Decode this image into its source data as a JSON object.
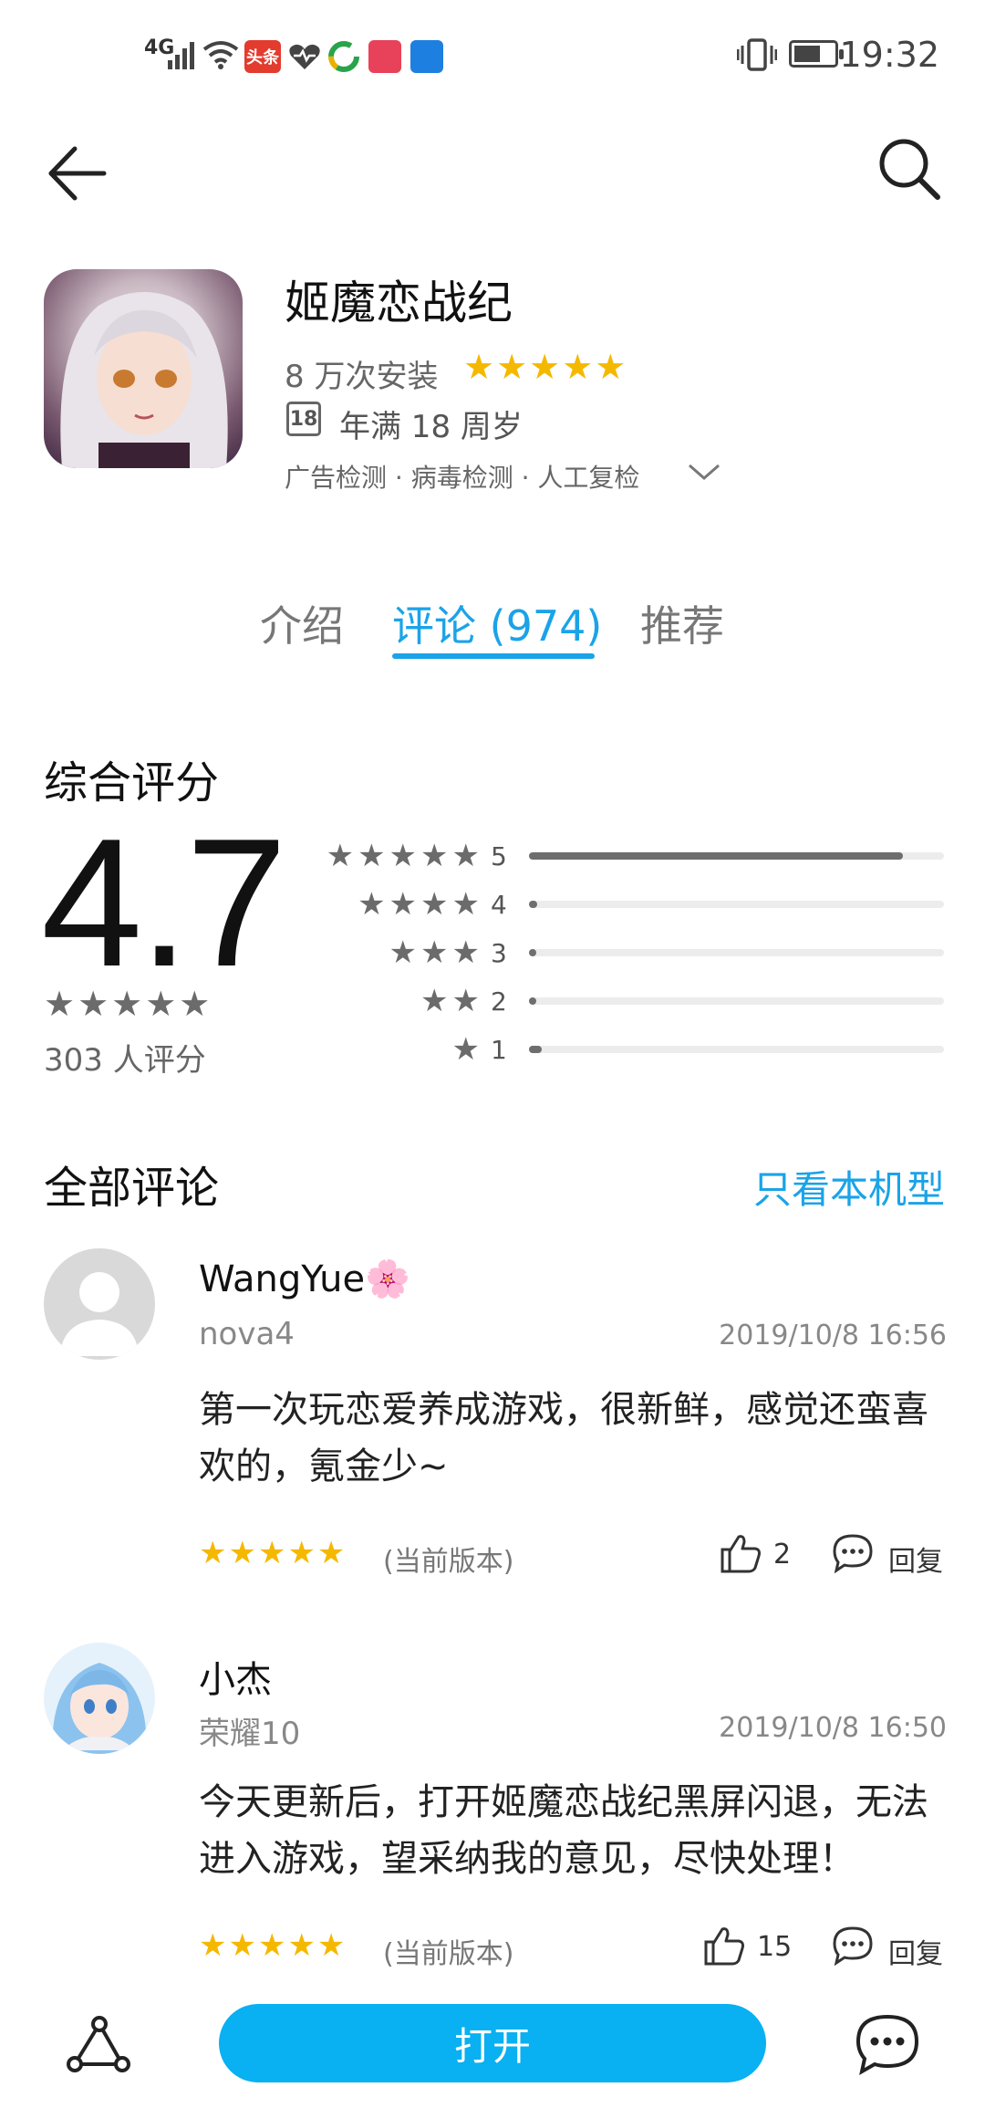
{
  "status_bar": {
    "network": "4G",
    "badges": [
      {
        "label": "头条",
        "color": "#e33b2e"
      },
      {
        "label": "",
        "color": "#e8425a"
      },
      {
        "label": "",
        "color": "#1d7fe0"
      }
    ],
    "time": "19:32"
  },
  "header": {
    "back_icon": "arrow-left-icon",
    "search_icon": "search-icon"
  },
  "app": {
    "title": "姬魔恋战纪",
    "installs": "8 万次安装",
    "stars": "★★★★★",
    "age_badge": "18",
    "age_text": "年满 18 周岁",
    "checks": "广告检测 · 病毒检测 · 人工复检"
  },
  "tabs": [
    {
      "label": "介绍",
      "active": false
    },
    {
      "label": "评论 (974)",
      "active": true
    },
    {
      "label": "推荐",
      "active": false
    }
  ],
  "rating": {
    "section_title": "综合评分",
    "score": "4.7",
    "stars": "★★★★★",
    "count": "303 人评分",
    "histogram": [
      {
        "stars": "★★★★★",
        "label": "5",
        "fraction": 0.9
      },
      {
        "stars": "★★★★",
        "label": "4",
        "fraction": 0.02
      },
      {
        "stars": "★★★",
        "label": "3",
        "fraction": 0.01
      },
      {
        "stars": "★★",
        "label": "2",
        "fraction": 0.01
      },
      {
        "stars": "★",
        "label": "1",
        "fraction": 0.03
      }
    ]
  },
  "reviews_section": {
    "title": "全部评论",
    "filter": "只看本机型"
  },
  "reviews": [
    {
      "user": "WangYue🌸",
      "device": "nova4",
      "date": "2019/10/8 16:56",
      "text": "第一次玩恋爱养成游戏，很新鲜，感觉还蛮喜欢的，氪金少~",
      "stars": "★★★★★",
      "version": "(当前版本)",
      "likes": "2",
      "reply": "回复"
    },
    {
      "user": "小杰",
      "device": "荣耀10",
      "date": "2019/10/8 16:50",
      "text": "今天更新后，打开姬魔恋战纪黑屏闪退，无法进入游戏，望采纳我的意见，尽快处理！",
      "stars": "★★★★★",
      "version": "(当前版本)",
      "likes": "15",
      "reply": "回复"
    }
  ],
  "bottom": {
    "open_label": "打开",
    "share_icon": "share-icon",
    "chat_icon": "chat-icon"
  },
  "colors": {
    "accent": "#1aa3e8",
    "button": "#09b0f2",
    "star": "#f5b800"
  }
}
